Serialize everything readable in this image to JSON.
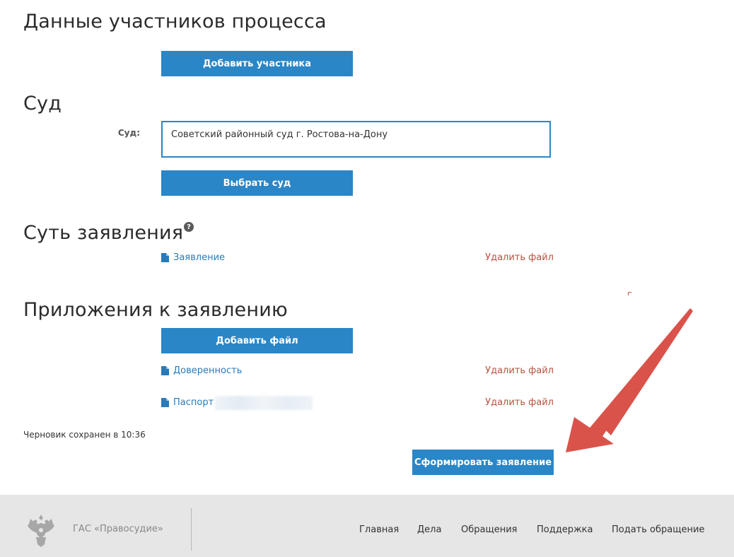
{
  "sections": {
    "participants_title": "Данные участников процесса",
    "court_title": "Суд",
    "essence_title": "Суть заявления",
    "attachments_title": "Приложения к заявлению"
  },
  "buttons": {
    "add_participant": "Добавить участника",
    "choose_court": "Выбрать суд",
    "add_file": "Добавить файл",
    "form_statement": "Сформировать заявление"
  },
  "court_field": {
    "label": "Суд:",
    "value": "Советский районный суд г. Ростова-на-Дону"
  },
  "essence_files": [
    {
      "name": "Заявление",
      "delete_label": "Удалить файл",
      "icon": "document-icon"
    }
  ],
  "attachment_files": [
    {
      "name": "Доверенность",
      "delete_label": "Удалить файл",
      "icon": "document-icon"
    },
    {
      "name": "Паспорт",
      "delete_label": "Удалить файл",
      "icon": "document-icon"
    }
  ],
  "help_icon": "?",
  "draft_status": "Черновик сохранен в 10:36",
  "footer": {
    "brand": "ГАС «Правосудие»",
    "logo_icon": "coat-of-arms-icon",
    "nav": [
      "Главная",
      "Дела",
      "Обращения",
      "Поддержка",
      "Подать обращение"
    ]
  },
  "colors": {
    "primary": "#2a86c6",
    "link": "#2a7ab8",
    "danger": "#b8513f",
    "annotation_arrow": "#d9534a",
    "footer_bg": "#e6e6e6"
  }
}
